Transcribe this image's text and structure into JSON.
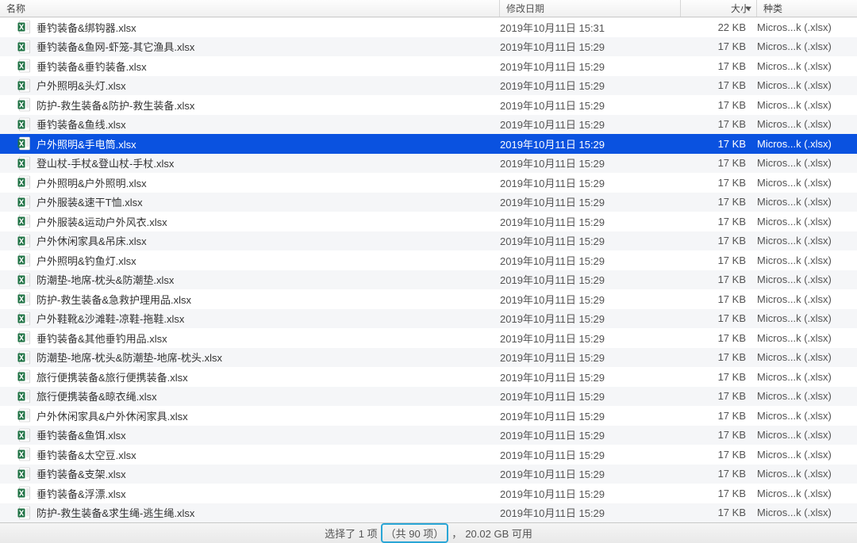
{
  "header": {
    "name": "名称",
    "date": "修改日期",
    "size": "大小",
    "kind": "种类"
  },
  "files": [
    {
      "name": "垂钓装备&绑钩器.xlsx",
      "date": "2019年10月11日 15:31",
      "size": "22 KB",
      "kind": "Micros...k (.xlsx)",
      "selected": false
    },
    {
      "name": "垂钓装备&鱼网-虾笼-其它渔具.xlsx",
      "date": "2019年10月11日 15:29",
      "size": "17 KB",
      "kind": "Micros...k (.xlsx)",
      "selected": false
    },
    {
      "name": "垂钓装备&垂钓装备.xlsx",
      "date": "2019年10月11日 15:29",
      "size": "17 KB",
      "kind": "Micros...k (.xlsx)",
      "selected": false
    },
    {
      "name": "户外照明&头灯.xlsx",
      "date": "2019年10月11日 15:29",
      "size": "17 KB",
      "kind": "Micros...k (.xlsx)",
      "selected": false
    },
    {
      "name": "防护-救生装备&防护-救生装备.xlsx",
      "date": "2019年10月11日 15:29",
      "size": "17 KB",
      "kind": "Micros...k (.xlsx)",
      "selected": false
    },
    {
      "name": "垂钓装备&鱼线.xlsx",
      "date": "2019年10月11日 15:29",
      "size": "17 KB",
      "kind": "Micros...k (.xlsx)",
      "selected": false
    },
    {
      "name": "户外照明&手电筒.xlsx",
      "date": "2019年10月11日 15:29",
      "size": "17 KB",
      "kind": "Micros...k (.xlsx)",
      "selected": true
    },
    {
      "name": "登山杖-手杖&登山杖-手杖.xlsx",
      "date": "2019年10月11日 15:29",
      "size": "17 KB",
      "kind": "Micros...k (.xlsx)",
      "selected": false
    },
    {
      "name": "户外照明&户外照明.xlsx",
      "date": "2019年10月11日 15:29",
      "size": "17 KB",
      "kind": "Micros...k (.xlsx)",
      "selected": false
    },
    {
      "name": "户外服装&速干T恤.xlsx",
      "date": "2019年10月11日 15:29",
      "size": "17 KB",
      "kind": "Micros...k (.xlsx)",
      "selected": false
    },
    {
      "name": "户外服装&运动户外风衣.xlsx",
      "date": "2019年10月11日 15:29",
      "size": "17 KB",
      "kind": "Micros...k (.xlsx)",
      "selected": false
    },
    {
      "name": "户外休闲家具&吊床.xlsx",
      "date": "2019年10月11日 15:29",
      "size": "17 KB",
      "kind": "Micros...k (.xlsx)",
      "selected": false
    },
    {
      "name": "户外照明&钓鱼灯.xlsx",
      "date": "2019年10月11日 15:29",
      "size": "17 KB",
      "kind": "Micros...k (.xlsx)",
      "selected": false
    },
    {
      "name": "防潮垫-地席-枕头&防潮垫.xlsx",
      "date": "2019年10月11日 15:29",
      "size": "17 KB",
      "kind": "Micros...k (.xlsx)",
      "selected": false
    },
    {
      "name": "防护-救生装备&急救护理用品.xlsx",
      "date": "2019年10月11日 15:29",
      "size": "17 KB",
      "kind": "Micros...k (.xlsx)",
      "selected": false
    },
    {
      "name": "户外鞋靴&沙滩鞋-凉鞋-拖鞋.xlsx",
      "date": "2019年10月11日 15:29",
      "size": "17 KB",
      "kind": "Micros...k (.xlsx)",
      "selected": false
    },
    {
      "name": "垂钓装备&其他垂钓用品.xlsx",
      "date": "2019年10月11日 15:29",
      "size": "17 KB",
      "kind": "Micros...k (.xlsx)",
      "selected": false
    },
    {
      "name": "防潮垫-地席-枕头&防潮垫-地席-枕头.xlsx",
      "date": "2019年10月11日 15:29",
      "size": "17 KB",
      "kind": "Micros...k (.xlsx)",
      "selected": false
    },
    {
      "name": "旅行便携装备&旅行便携装备.xlsx",
      "date": "2019年10月11日 15:29",
      "size": "17 KB",
      "kind": "Micros...k (.xlsx)",
      "selected": false
    },
    {
      "name": "旅行便携装备&晾衣绳.xlsx",
      "date": "2019年10月11日 15:29",
      "size": "17 KB",
      "kind": "Micros...k (.xlsx)",
      "selected": false
    },
    {
      "name": "户外休闲家具&户外休闲家具.xlsx",
      "date": "2019年10月11日 15:29",
      "size": "17 KB",
      "kind": "Micros...k (.xlsx)",
      "selected": false
    },
    {
      "name": "垂钓装备&鱼饵.xlsx",
      "date": "2019年10月11日 15:29",
      "size": "17 KB",
      "kind": "Micros...k (.xlsx)",
      "selected": false
    },
    {
      "name": "垂钓装备&太空豆.xlsx",
      "date": "2019年10月11日 15:29",
      "size": "17 KB",
      "kind": "Micros...k (.xlsx)",
      "selected": false
    },
    {
      "name": "垂钓装备&支架.xlsx",
      "date": "2019年10月11日 15:29",
      "size": "17 KB",
      "kind": "Micros...k (.xlsx)",
      "selected": false
    },
    {
      "name": "垂钓装备&浮漂.xlsx",
      "date": "2019年10月11日 15:29",
      "size": "17 KB",
      "kind": "Micros...k (.xlsx)",
      "selected": false
    },
    {
      "name": "防护-救生装备&求生绳-逃生绳.xlsx",
      "date": "2019年10月11日 15:29",
      "size": "17 KB",
      "kind": "Micros...k (.xlsx)",
      "selected": false
    }
  ],
  "status": {
    "selected_text": "选择了 1 项",
    "total_text": "（共 90 项）",
    "sep": "，",
    "disk_text": "20.02 GB 可用"
  }
}
